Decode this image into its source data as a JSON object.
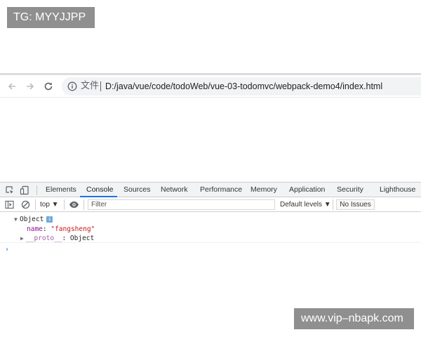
{
  "watermarks": {
    "top_left": "TG: MYYJJPP",
    "bottom_right": "www.vip–nbapk.com"
  },
  "browser": {
    "nav": {
      "back_icon": "arrow-left-icon",
      "forward_icon": "arrow-right-icon",
      "reload_icon": "reload-icon"
    },
    "address_bar": {
      "info_icon": "info-circle-icon",
      "scheme_label": "文件",
      "url": "D:/java/vue/code/todoWeb/vue-03-todomvc/webpack-demo4/index.html"
    }
  },
  "devtools": {
    "tabs": [
      {
        "label": "Elements"
      },
      {
        "label": "Console",
        "active": true
      },
      {
        "label": "Sources"
      },
      {
        "label": "Network"
      },
      {
        "label": "Performance"
      },
      {
        "label": "Memory"
      },
      {
        "label": "Application"
      },
      {
        "label": "Security"
      },
      {
        "label": "Lighthouse"
      }
    ],
    "console_bar": {
      "context": "top ▼",
      "filter_placeholder": "Filter",
      "levels": "Default levels ▼",
      "issues": "No Issues"
    },
    "output": {
      "object_label": "Object",
      "info_badge": "i",
      "prop_key": "name",
      "prop_value": "\"fangsheng\"",
      "proto_key": "__proto__",
      "proto_value": ": Object",
      "prompt": "›"
    },
    "colors": {
      "accent": "#1a73e8",
      "string": "#c41a16",
      "key": "#881391"
    }
  }
}
